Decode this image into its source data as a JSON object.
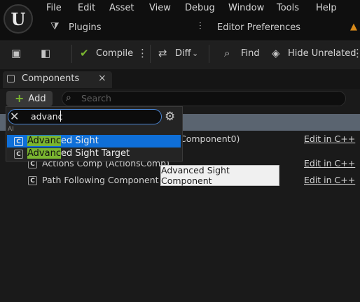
{
  "menu": [
    "File",
    "Edit",
    "Asset",
    "View",
    "Debug",
    "Window",
    "Tools",
    "Help"
  ],
  "submenu": {
    "plugins": "Plugins",
    "editor_prefs": "Editor Preferences"
  },
  "toolbar": {
    "compile": "Compile",
    "diff": "Diff",
    "find": "Find",
    "hide_unrelated": "Hide Unrelated"
  },
  "panel": {
    "tab_title": "Components",
    "add_label": "Add",
    "search_placeholder": "Search",
    "rows": [
      {
        "label": "Component0)",
        "edit": "Edit in C++"
      },
      {
        "label": "Actions Comp (ActionsComp)",
        "edit": "Edit in C++"
      },
      {
        "label": "Path Following Component (Pa",
        "edit": "Edit in C++"
      }
    ]
  },
  "popup": {
    "search_value": "advanc",
    "category": "AI",
    "items": [
      {
        "match": "Advanc",
        "rest": "ed Sight"
      },
      {
        "match": "Advanc",
        "rest": "ed Sight Target"
      }
    ]
  },
  "tooltip": "Advanced Sight Component",
  "colors": {
    "highlight": "#7ab530",
    "selected": "#0f6fd8",
    "focus_border": "#4a86d6"
  }
}
